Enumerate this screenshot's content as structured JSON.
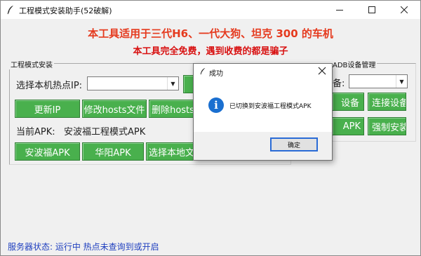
{
  "window": {
    "title": "工程模式安装助手(52破解)"
  },
  "banner": {
    "line1": "本工具适用于三代H6、一代大狗、坦克 300 的车机",
    "line2": "本工具完全免费，遇到收费的都是骗子"
  },
  "install_panel": {
    "label": "工程模式安装",
    "hotspot_label": "选择本机热点IP:",
    "hotspot_value": "",
    "buttons_row1": [
      "更新IP",
      "修改hosts文件",
      "删除hosts"
    ],
    "current_apk_label": "当前APK:",
    "current_apk_value": "安波福工程模式APK",
    "buttons_row2": [
      "安波福APK",
      "华阳APK",
      "选择本地文"
    ]
  },
  "adb_panel": {
    "label": "ADB设备管理",
    "device_label": "备:",
    "device_value": "",
    "buttons": [
      "设备",
      "连接设备",
      "APK",
      "强制安装"
    ]
  },
  "status_bar": {
    "text": "服务器状态: 运行中   热点未查询到或开启"
  },
  "dialog": {
    "title": "成功",
    "message": "已切换到安波福工程模式APK",
    "ok_label": "确定"
  },
  "colors": {
    "button_green": "#49b04d",
    "banner_orange": "#e53a1e",
    "banner_red": "#d81010",
    "status_blue": "#1f3fbf",
    "info_blue": "#1a6fd0"
  }
}
